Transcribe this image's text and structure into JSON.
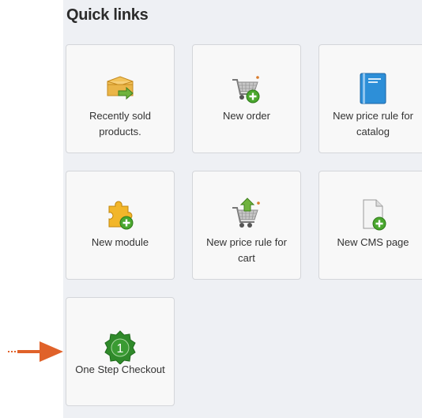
{
  "section_title": "Quick links",
  "tiles": [
    {
      "label": "Recently sold products.",
      "icon": "box-arrow-icon"
    },
    {
      "label": "New order",
      "icon": "cart-plus-icon"
    },
    {
      "label": "New price rule for catalog",
      "icon": "book-icon"
    },
    {
      "label": "New module",
      "icon": "puzzle-plus-icon"
    },
    {
      "label": "New price rule for cart",
      "icon": "cart-arrow-icon"
    },
    {
      "label": "New CMS page",
      "icon": "page-plus-icon"
    },
    {
      "label": "One Step Checkout",
      "icon": "badge-one-icon"
    }
  ],
  "badge_number": "1",
  "colors": {
    "arrow": "#e0622a",
    "badge": "#2f8a2a",
    "plus": "#4aa72e"
  }
}
